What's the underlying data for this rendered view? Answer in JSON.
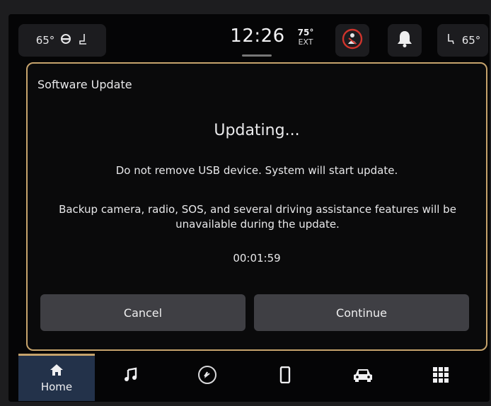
{
  "status_bar": {
    "driver_temp": "65°",
    "passenger_temp": "65°",
    "clock": "12:26",
    "outside_temp": "75°",
    "outside_label": "EXT"
  },
  "dialog": {
    "title": "Software Update",
    "heading": "Updating...",
    "message_1": "Do not remove USB device. System will start update.",
    "message_2": "Backup camera, radio, SOS, and several driving assistance features will be unavailable during the update.",
    "timer": "00:01:59",
    "cancel_label": "Cancel",
    "continue_label": "Continue"
  },
  "nav": {
    "home_label": "Home",
    "icons": [
      "home-icon",
      "music-note-icon",
      "steering-wheel-icon",
      "phone-icon",
      "car-icon",
      "apps-grid-icon"
    ]
  },
  "colors": {
    "dialog_border": "#c6a36c",
    "home_active_bg": "#23324a",
    "alert_red": "#d0342c"
  }
}
